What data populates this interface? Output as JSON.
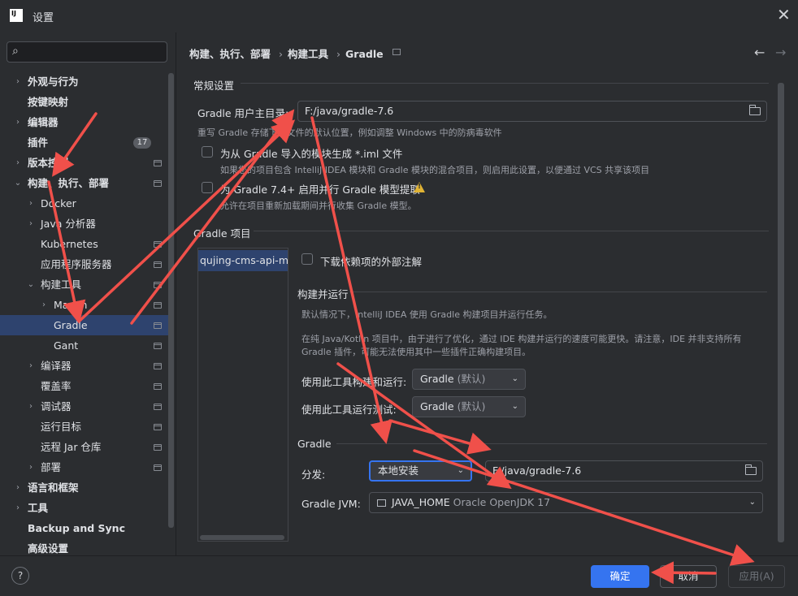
{
  "window": {
    "icon_text": "IJ",
    "title": "设置",
    "close_glyph": "✕"
  },
  "sidebar": {
    "search_icon": "⌕",
    "items": [
      {
        "label": "外观与行为",
        "chevron": "›",
        "bold": true
      },
      {
        "label": "按键映射",
        "bold": true
      },
      {
        "label": "编辑器",
        "chevron": "›",
        "bold": true
      },
      {
        "label": "插件",
        "bold": true,
        "badge": "17"
      },
      {
        "label": "版本控制",
        "chevron": "›",
        "bold": true
      },
      {
        "label": "构建、执行、部署",
        "chevron": "⌄",
        "bold": true
      },
      {
        "label": "Docker",
        "chevron": "›"
      },
      {
        "label": "Java 分析器",
        "chevron": "›"
      },
      {
        "label": "Kubernetes"
      },
      {
        "label": "应用程序服务器"
      },
      {
        "label": "构建工具",
        "chevron": "⌄"
      },
      {
        "label": "Maven",
        "chevron": "›"
      },
      {
        "label": "Gradle",
        "selected": true
      },
      {
        "label": "Gant"
      },
      {
        "label": "编译器",
        "chevron": "›"
      },
      {
        "label": "覆盖率"
      },
      {
        "label": "调试器",
        "chevron": "›"
      },
      {
        "label": "运行目标"
      },
      {
        "label": "远程 Jar 仓库"
      },
      {
        "label": "部署",
        "chevron": "›"
      },
      {
        "label": "语言和框架",
        "chevron": "›",
        "bold": true
      },
      {
        "label": "工具",
        "chevron": "›",
        "bold": true
      },
      {
        "label": "Backup and Sync",
        "bold": true
      },
      {
        "label": "高级设置",
        "bold": true
      }
    ]
  },
  "breadcrumb": [
    "构建、执行、部署",
    "构建工具",
    "Gradle"
  ],
  "breadcrumb_sep": "›",
  "nav": {
    "back": "←",
    "forward": "→"
  },
  "general": {
    "title": "常规设置",
    "user_home_label": "Gradle 用户主目录:",
    "user_home_value": "F:/java/gradle-7.6",
    "user_home_hint": "重写 Gradle 存储下载文件的默认位置，例如调整 Windows 中的防病毒软件",
    "iml_label": "为从 Gradle 导入的模块生成 *.iml 文件",
    "iml_hint": "如果您的项目包含 IntelliJ IDEA 模块和 Gradle 模块的混合项目，则启用此设置，以便通过 VCS 共享该项目",
    "parallel_label": "为 Gradle 7.4+ 启用并行 Gradle 模型提取",
    "parallel_hint": "允许在项目重新加载期间并行收集 Gradle 模型。"
  },
  "projects": {
    "title": "Gradle 项目",
    "items": [
      "qujing-cms-api-ma"
    ],
    "download_annotations_label": "下载依赖项的外部注解"
  },
  "build_run": {
    "title": "构建并运行",
    "desc1": "默认情况下，IntelliJ IDEA 使用 Gradle 构建项目并运行任务。",
    "desc2": "在纯 Java/Kotlin 项目中，由于进行了优化，通过 IDE 构建并运行的速度可能更快。请注意，IDE 并非支持所有",
    "desc3": "Gradle 插件，可能无法使用其中一些插件正确构建项目。",
    "build_label": "使用此工具构建和运行:",
    "build_value": "Gradle",
    "build_suffix": "(默认)",
    "test_label": "使用此工具运行测试:",
    "test_value": "Gradle",
    "test_suffix": "(默认)",
    "arrow": "⌄"
  },
  "gradle": {
    "title": "Gradle",
    "distribution_label": "分发:",
    "distribution_value": "本地安装",
    "local_path": "F:/java/gradle-7.6",
    "jvm_label": "Gradle JVM:",
    "jvm_value": "JAVA_HOME",
    "jvm_detail": "Oracle OpenJDK 17"
  },
  "footer": {
    "help": "?",
    "ok": "确定",
    "cancel": "取消",
    "apply": "应用(A)"
  },
  "colors": {
    "background": "#2b2d30",
    "selection": "#2e436e",
    "primary_button": "#3574f0",
    "annotation_arrow": "#f0504a",
    "warning": "#e0b334"
  }
}
